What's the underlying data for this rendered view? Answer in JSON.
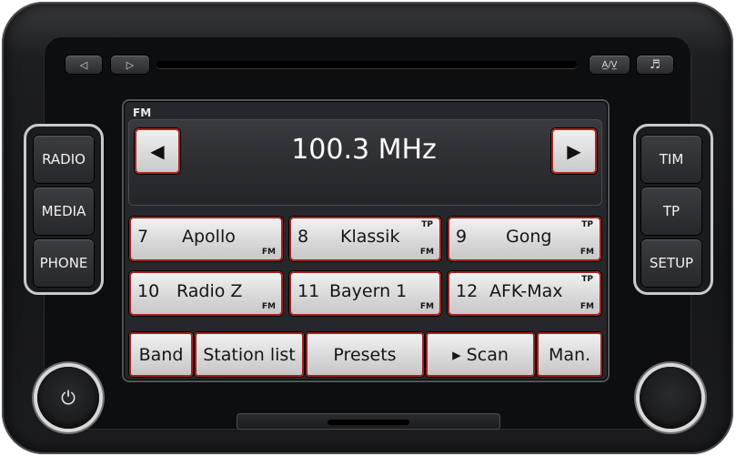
{
  "top_controls": {
    "prev_symbol": "◁",
    "next_symbol": "▷",
    "display_mode_symbol": "A̲/V̲",
    "music_symbol": "♬"
  },
  "side_left": {
    "radio": "RADIO",
    "media": "MEDIA",
    "phone": "PHONE"
  },
  "side_right": {
    "tim": "TIM",
    "tp": "TP",
    "setup": "SETUP"
  },
  "display": {
    "band": "FM",
    "frequency": "100.3 MHz",
    "seek_left_symbol": "◀",
    "seek_right_symbol": "▶"
  },
  "presets": [
    {
      "number": "7",
      "name": "Apollo",
      "tp": "",
      "band": "FM"
    },
    {
      "number": "8",
      "name": "Klassik",
      "tp": "TP",
      "band": "FM"
    },
    {
      "number": "9",
      "name": "Gong",
      "tp": "TP",
      "band": "FM"
    },
    {
      "number": "10",
      "name": "Radio Z",
      "tp": "",
      "band": "FM"
    },
    {
      "number": "11",
      "name": "Bayern 1",
      "tp": "",
      "band": "FM"
    },
    {
      "number": "12",
      "name": "AFK-Max",
      "tp": "TP",
      "band": "FM"
    }
  ],
  "menu": {
    "band": "Band",
    "station_list": "Station list",
    "presets": "Presets",
    "scan": "▸ Scan",
    "manual": "Man."
  },
  "knobs": {
    "power_symbol": "⏻"
  },
  "colors": {
    "accent_red": "#a31f1f",
    "screen_bg": "#26272a"
  }
}
